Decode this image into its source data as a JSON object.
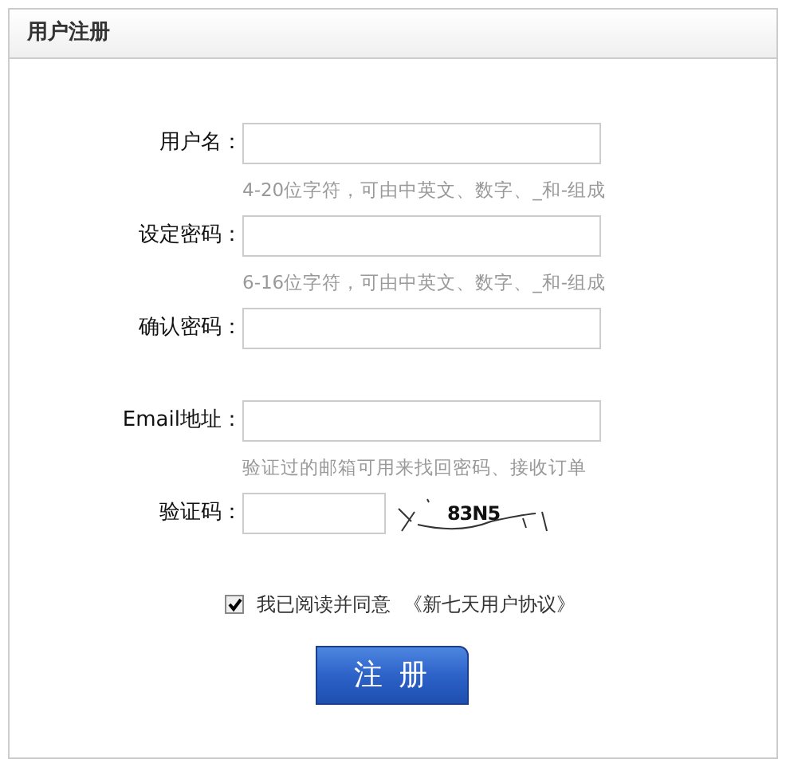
{
  "panel": {
    "title": "用户注册"
  },
  "fields": [
    {
      "kind": "text",
      "label": "用户名：",
      "hint": "4-20位字符，可由中英文、数字、_和-组成"
    },
    {
      "kind": "text",
      "label": "设定密码：",
      "hint": "6-16位字符，可由中英文、数字、_和-组成"
    },
    {
      "kind": "text",
      "label": "确认密码："
    },
    {
      "kind": "text",
      "label": "Email地址：",
      "hint": "验证过的邮箱可用来找回密码、接收订单"
    },
    {
      "kind": "captcha",
      "label": "验证码：",
      "captcha": "83N5"
    }
  ],
  "agreement": {
    "checked": true,
    "text": "我已阅读并同意",
    "link": "《新七天用户协议》"
  },
  "submit": "注 册"
}
